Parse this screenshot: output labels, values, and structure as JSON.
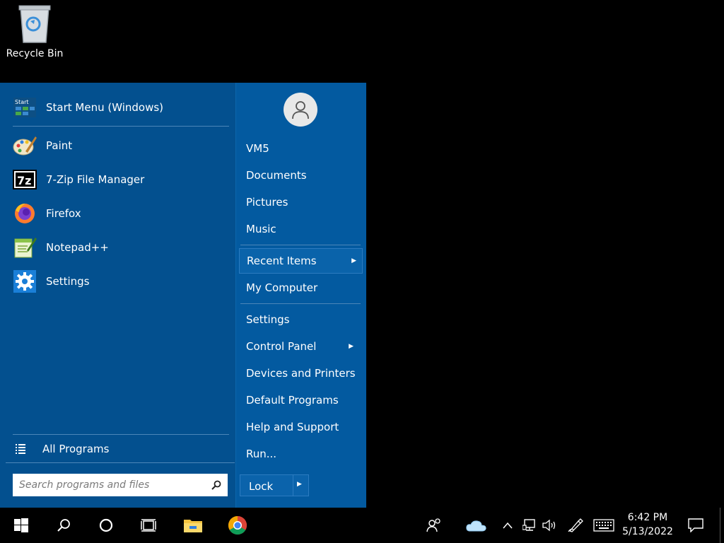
{
  "desktop": {
    "recycle_bin_label": "Recycle Bin"
  },
  "start_menu": {
    "pinned": {
      "label": "Start Menu (Windows)",
      "icon": "start-menu-icon"
    },
    "apps": [
      {
        "label": "Paint",
        "icon": "paint-icon"
      },
      {
        "label": "7-Zip File Manager",
        "icon": "7zip-icon"
      },
      {
        "label": "Firefox",
        "icon": "firefox-icon"
      },
      {
        "label": "Notepad++",
        "icon": "notepadpp-icon"
      },
      {
        "label": "Settings",
        "icon": "settings-gear-icon"
      }
    ],
    "all_programs": "All Programs",
    "search": {
      "placeholder": "Search programs and files"
    },
    "right": {
      "user": "VM5",
      "items": [
        "Documents",
        "Pictures",
        "Music",
        "Recent Items",
        "My Computer",
        "Settings",
        "Control Panel",
        "Devices and Printers",
        "Default Programs",
        "Help and Support",
        "Run..."
      ],
      "lock_label": "Lock"
    }
  },
  "taskbar": {
    "clock_time": "6:42 PM",
    "clock_date": "5/13/2022"
  },
  "colors": {
    "menu_bg": "#03508f",
    "right_pane_bg": "#035aa0",
    "taskbar_bg": "#000000"
  }
}
